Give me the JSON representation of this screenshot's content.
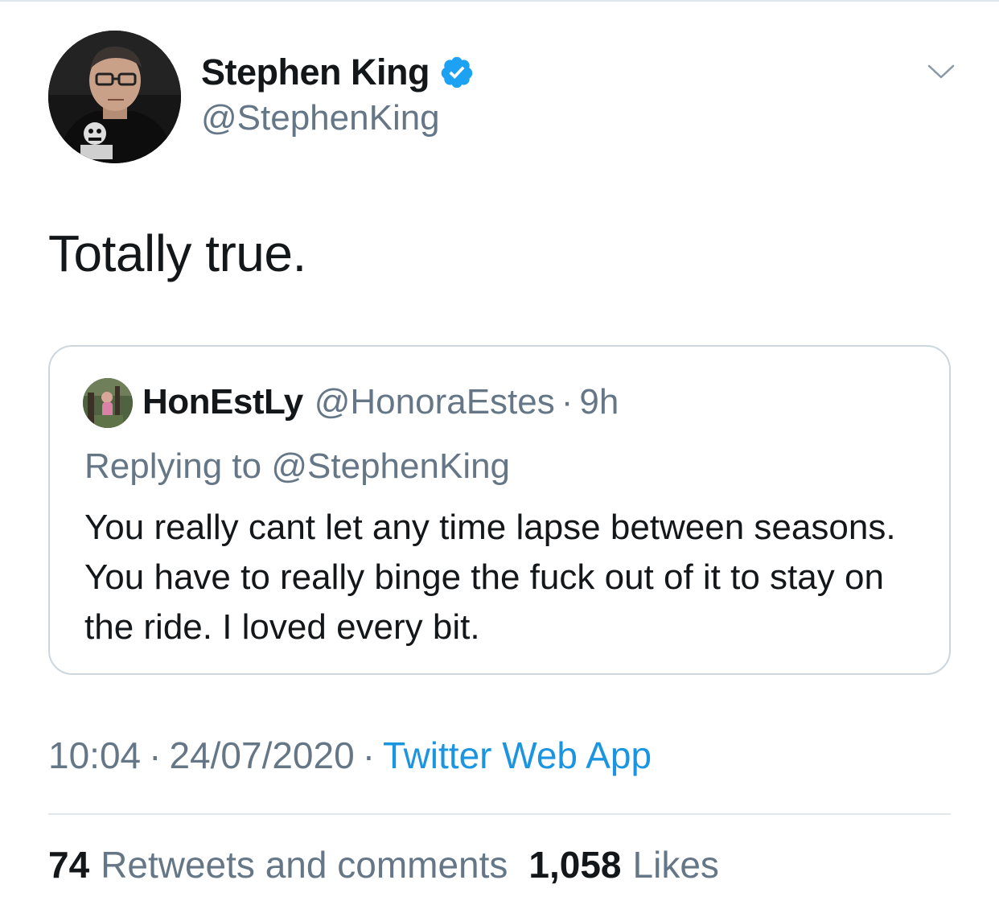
{
  "author": {
    "display_name": "Stephen King",
    "handle": "@StephenKing",
    "verified": true
  },
  "tweet": {
    "text": "Totally true."
  },
  "quoted_tweet": {
    "display_name": "HonEstLy",
    "handle": "@HonoraEstes",
    "separator": "·",
    "time_ago": "9h",
    "replying_prefix": "Replying to",
    "replying_handle": "@StephenKing",
    "text": "You really cant let any time lapse between seasons. You have to really binge the fuck out of it to stay on the ride. I loved every bit."
  },
  "meta": {
    "time": "10:04",
    "separator": "·",
    "date": "24/07/2020",
    "source": "Twitter Web App"
  },
  "stats": {
    "retweets_count": "74",
    "retweets_label": "Retweets and comments",
    "likes_count": "1,058",
    "likes_label": "Likes"
  },
  "icons": {
    "verified": "verified-badge-icon",
    "menu": "chevron-down-icon"
  },
  "colors": {
    "text_primary": "#14171a",
    "text_secondary": "#657786",
    "link": "#1b95e0",
    "verified": "#1da1f2",
    "border": "#ccd6dd"
  }
}
